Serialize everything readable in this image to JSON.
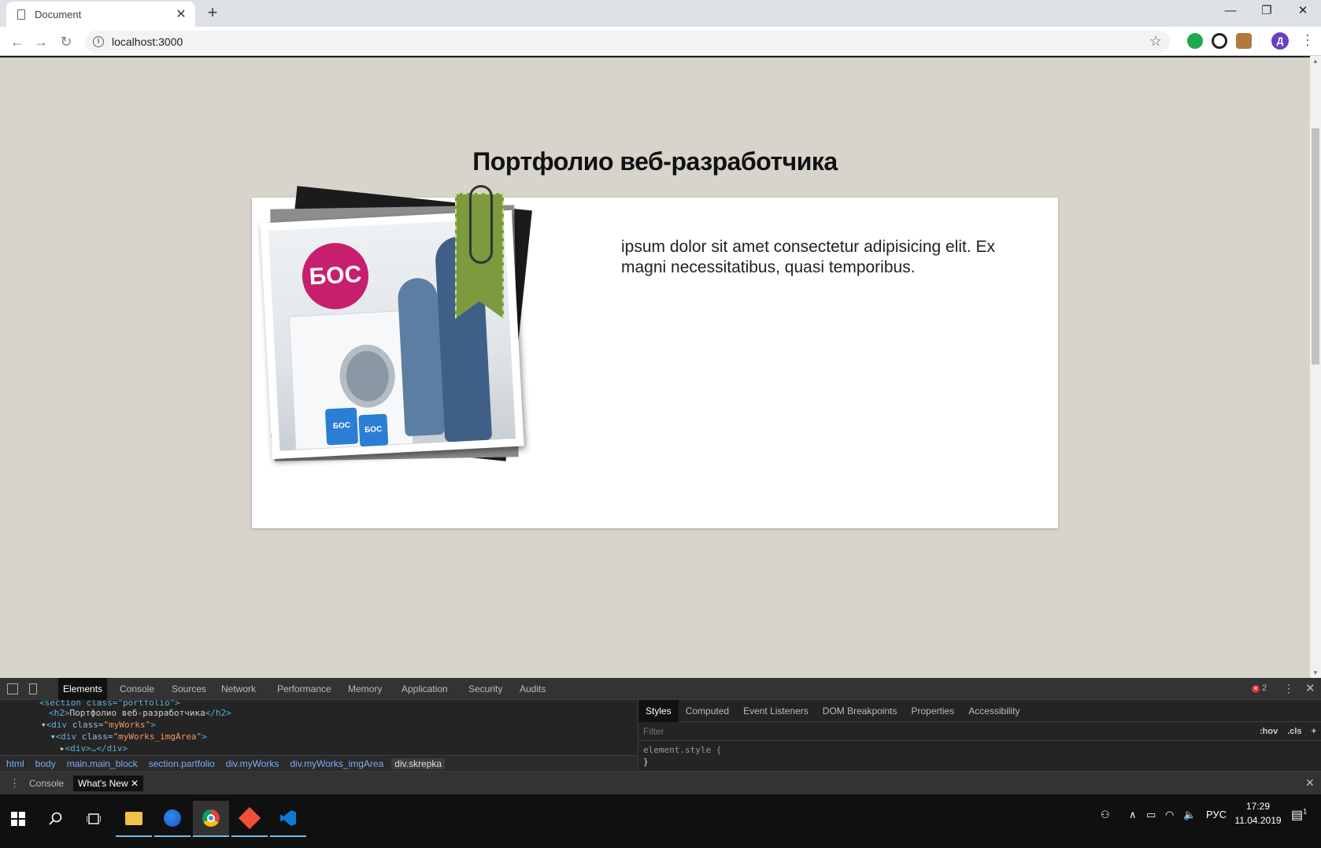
{
  "browser": {
    "tab_title": "Document",
    "tab_close": "✕",
    "new_tab": "+",
    "url": "localhost:3000",
    "profile_initial": "Д",
    "window_controls": [
      "—",
      "❐",
      "✕"
    ]
  },
  "page": {
    "heading": "Портфолио веб-разработчика",
    "body_text": "ipsum dolor sit amet consectetur adipisicing elit. Ex magni necessitatibus, quasi temporibus.",
    "logo_text": "БОС",
    "box1_text": "БОС",
    "box2_text": "БОС"
  },
  "devtools": {
    "tabs": [
      "Elements",
      "Console",
      "Sources",
      "Network",
      "Performance",
      "Memory",
      "Application",
      "Security",
      "Audits"
    ],
    "error_count": "2",
    "dom_lines": {
      "l0_text": "<section class=\"portfolio\">",
      "l1_open": "<h2>",
      "l1_text": "Портфолио веб-разработчика",
      "l1_close": "</h2>",
      "l2_tag": "<div ",
      "l2_attr": "class=",
      "l2_val": "\"myWorks\"",
      "l2_end": ">",
      "l3_tag": "<div ",
      "l3_attr": "class=",
      "l3_val": "\"myWorks_imgArea\"",
      "l3_end": ">",
      "l4_text": "<div>…</div>"
    },
    "breadcrumbs": [
      "html",
      "body",
      "main.main_block",
      "section.partfolio",
      "div.myWorks",
      "div.myWorks_imgArea",
      "div.skrepka"
    ],
    "styles_tabs": [
      "Styles",
      "Computed",
      "Event Listeners",
      "DOM Breakpoints",
      "Properties",
      "Accessibility"
    ],
    "filter_placeholder": "Filter",
    "filter_hov": ":hov",
    "filter_cls": ".cls",
    "filter_add": "+",
    "style_rule_selector": "element.style {",
    "style_rule_close": "}",
    "drawer_tabs": [
      "Console",
      "What's New"
    ],
    "drawer_tab_close": "✕"
  },
  "taskbar": {
    "language": "РУС",
    "time": "17:29",
    "date": "11.04.2019",
    "notification_count": "1"
  }
}
